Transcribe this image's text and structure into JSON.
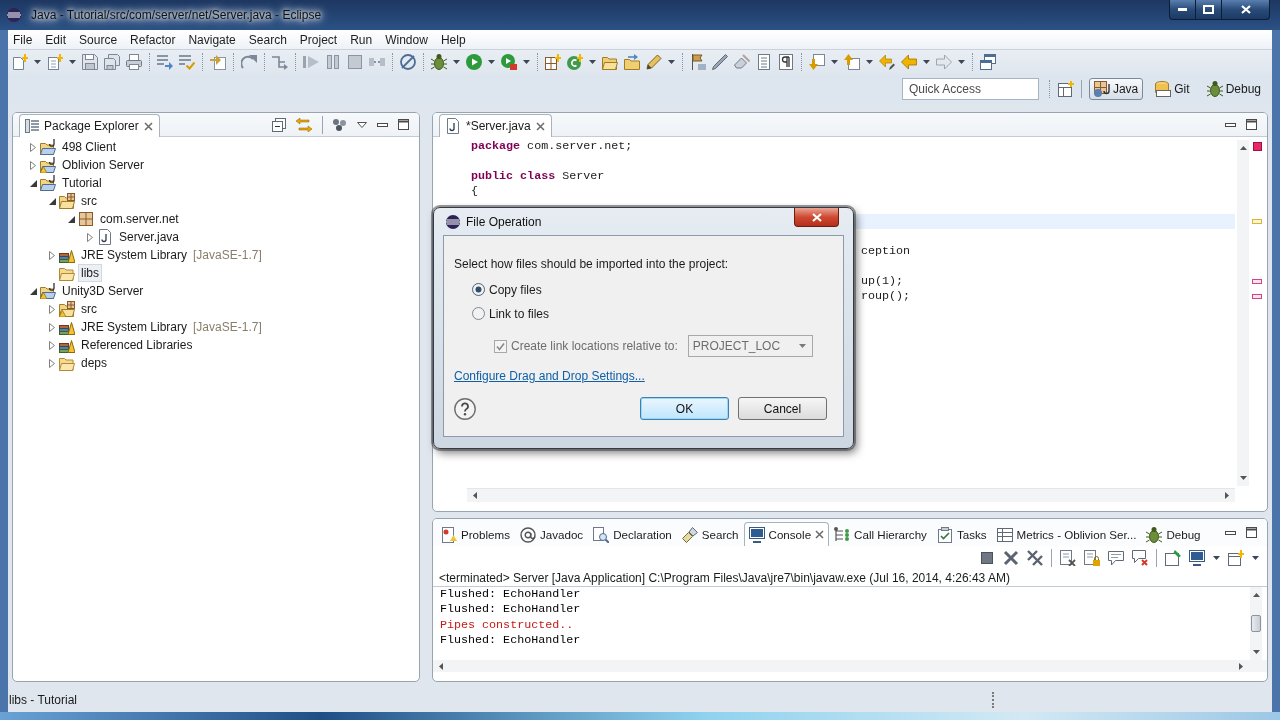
{
  "window": {
    "title": "Java - Tutorial/src/com/server/net/Server.java - Eclipse"
  },
  "menu": [
    "File",
    "Edit",
    "Source",
    "Refactor",
    "Navigate",
    "Search",
    "Project",
    "Run",
    "Window",
    "Help"
  ],
  "quick_access": {
    "placeholder": "Quick Access"
  },
  "perspectives": [
    {
      "label": "Java",
      "kind": "java",
      "selected": true
    },
    {
      "label": "Git",
      "kind": "git",
      "selected": false
    },
    {
      "label": "Debug",
      "kind": "debug",
      "selected": false
    }
  ],
  "package_explorer": {
    "tab": "Package Explorer",
    "tree": [
      {
        "label": "498 Client",
        "kind": "project",
        "warning": false,
        "expanded": false,
        "selected": false
      },
      {
        "label": "Oblivion Server",
        "kind": "project",
        "warning": true,
        "expanded": false,
        "selected": false
      },
      {
        "label": "Tutorial",
        "kind": "project",
        "warning": false,
        "expanded": true,
        "selected": false,
        "children": [
          {
            "label": "src",
            "kind": "source-folder",
            "warning": false,
            "expanded": true,
            "selected": false,
            "children": [
              {
                "label": "com.server.net",
                "kind": "package",
                "warning": false,
                "expanded": true,
                "selected": false,
                "children": [
                  {
                    "label": "Server.java",
                    "kind": "java-file",
                    "warning": false,
                    "expanded": false,
                    "selected": false
                  }
                ]
              }
            ]
          },
          {
            "label": "JRE System Library",
            "decoration": "[JavaSE-1.7]",
            "kind": "library",
            "warning": false,
            "expanded": false,
            "selected": false
          },
          {
            "label": "libs",
            "kind": "folder",
            "warning": false,
            "selected": true
          }
        ]
      },
      {
        "label": "Unity3D Server",
        "kind": "project",
        "warning": true,
        "expanded": true,
        "selected": false,
        "children": [
          {
            "label": "src",
            "kind": "source-folder",
            "warning": true,
            "expanded": false,
            "selected": false
          },
          {
            "label": "JRE System Library",
            "decoration": "[JavaSE-1.7]",
            "kind": "library",
            "warning": false,
            "expanded": false,
            "selected": false
          },
          {
            "label": "Referenced Libraries",
            "kind": "library",
            "warning": false,
            "expanded": false,
            "selected": false
          },
          {
            "label": "deps",
            "kind": "folder",
            "warning": false,
            "expanded": false,
            "selected": false
          }
        ]
      }
    ]
  },
  "editor": {
    "tab": "*Server.java",
    "lines": [
      {
        "kind": "code",
        "text": "**package** com.server.net;",
        "current": false
      },
      {
        "kind": "blank"
      },
      {
        "kind": "code",
        "text": "**public** **class** Server",
        "current": false
      },
      {
        "kind": "code",
        "text": "{",
        "current": false
      },
      {
        "kind": "covered"
      },
      {
        "kind": "covered",
        "current": true,
        "marker": {
          "kind": "warning"
        }
      },
      {
        "kind": "covered"
      },
      {
        "kind": "fragment",
        "text": "ception",
        "current": false
      },
      {
        "kind": "covered"
      },
      {
        "kind": "fragment",
        "text": "up(1);",
        "current": false,
        "marker": {
          "kind": "error"
        }
      },
      {
        "kind": "fragment",
        "text": "roup();",
        "current": false,
        "marker": {
          "kind": "error"
        }
      }
    ]
  },
  "dialog": {
    "title": "File Operation",
    "prompt": "Select how files should be imported into the project:",
    "options": [
      {
        "label": "Copy files",
        "selected": true
      },
      {
        "label": "Link to files",
        "selected": false
      }
    ],
    "relative_option": {
      "label": "Create link locations relative to:",
      "checked": true,
      "disabled": true
    },
    "relative_to": {
      "value": "PROJECT_LOC",
      "disabled": true
    },
    "link": "Configure Drag and Drop Settings...",
    "buttons": [
      {
        "label": "OK",
        "default": true
      },
      {
        "label": "Cancel",
        "default": false
      }
    ]
  },
  "bottom_panel": {
    "tabs": [
      {
        "label": "Problems",
        "kind": "problems",
        "selected": false
      },
      {
        "label": "Javadoc",
        "kind": "javadoc",
        "selected": false
      },
      {
        "label": "Declaration",
        "kind": "declaration",
        "selected": false
      },
      {
        "label": "Search",
        "kind": "search",
        "selected": false
      },
      {
        "label": "Console",
        "kind": "console",
        "selected": true
      },
      {
        "label": "Call Hierarchy",
        "kind": "call-hierarchy",
        "selected": false
      },
      {
        "label": "Tasks",
        "kind": "tasks",
        "selected": false
      },
      {
        "label": "Metrics - Oblivion Ser...",
        "kind": "metrics",
        "selected": false
      },
      {
        "label": "Debug",
        "kind": "debug",
        "selected": false
      }
    ],
    "console": {
      "header": "<terminated> Server [Java Application] C:\\Program Files\\Java\\jre7\\bin\\javaw.exe (Jul 16, 2014, 4:26:43 AM)",
      "lines": [
        {
          "text": "Flushed: EchoHandler",
          "kind": "out"
        },
        {
          "text": "Flushed: EchoHandler",
          "kind": "out"
        },
        {
          "text": "Pipes constructed..",
          "kind": "err"
        },
        {
          "text": "Flushed: EchoHandler",
          "kind": "out"
        }
      ]
    }
  },
  "status_bar": {
    "text": "libs - Tutorial"
  }
}
